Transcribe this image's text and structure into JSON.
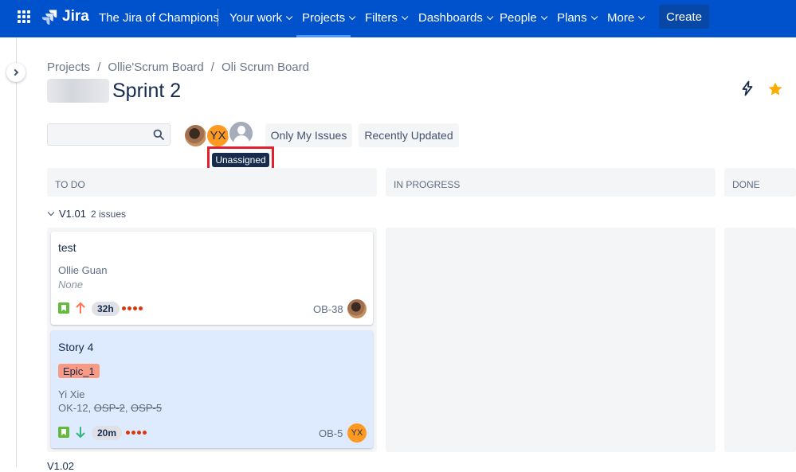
{
  "nav": {
    "brand": "Jira",
    "site": "The Jira of Champions",
    "items": [
      "Your work",
      "Projects",
      "Filters",
      "Dashboards",
      "People",
      "Plans",
      "More"
    ],
    "create": "Create"
  },
  "breadcrumb": [
    "Projects",
    "Ollie'Scrum Board",
    "Oli Scrum Board"
  ],
  "page_title": "Sprint 2",
  "filters": {
    "search_placeholder": "",
    "avatar_yx": "YX",
    "only_my_issues": "Only My Issues",
    "recently_updated": "Recently Updated",
    "tooltip": "Unassigned"
  },
  "columns": [
    "TO DO",
    "IN PROGRESS",
    "DONE"
  ],
  "swimlane": {
    "name": "V1.01",
    "count": "2 issues"
  },
  "swimlane2": {
    "name": "V1.02"
  },
  "cards": [
    {
      "title": "test",
      "assignee": "Ollie Guan",
      "secondary": "None",
      "estimate": "32h",
      "key": "OB-38",
      "priority": "high",
      "avatar": "photo"
    },
    {
      "title": "Story 4",
      "epic": "Epic_1",
      "assignee": "Yi Xie",
      "links_active": "OK-12, ",
      "links_done_1": "OSP-2",
      "links_sep": ", ",
      "links_done_2": "OSP-5",
      "estimate": "20m",
      "key": "OB-5",
      "priority": "low",
      "avatar_initials": "YX"
    }
  ],
  "colors": {
    "nav_bg": "#0052cc",
    "create_bg": "#0747a6",
    "story_green": "#63ba3c",
    "epic_label": "#f79a86",
    "selected_card": "#deebff",
    "highlight": "#e5202e"
  }
}
